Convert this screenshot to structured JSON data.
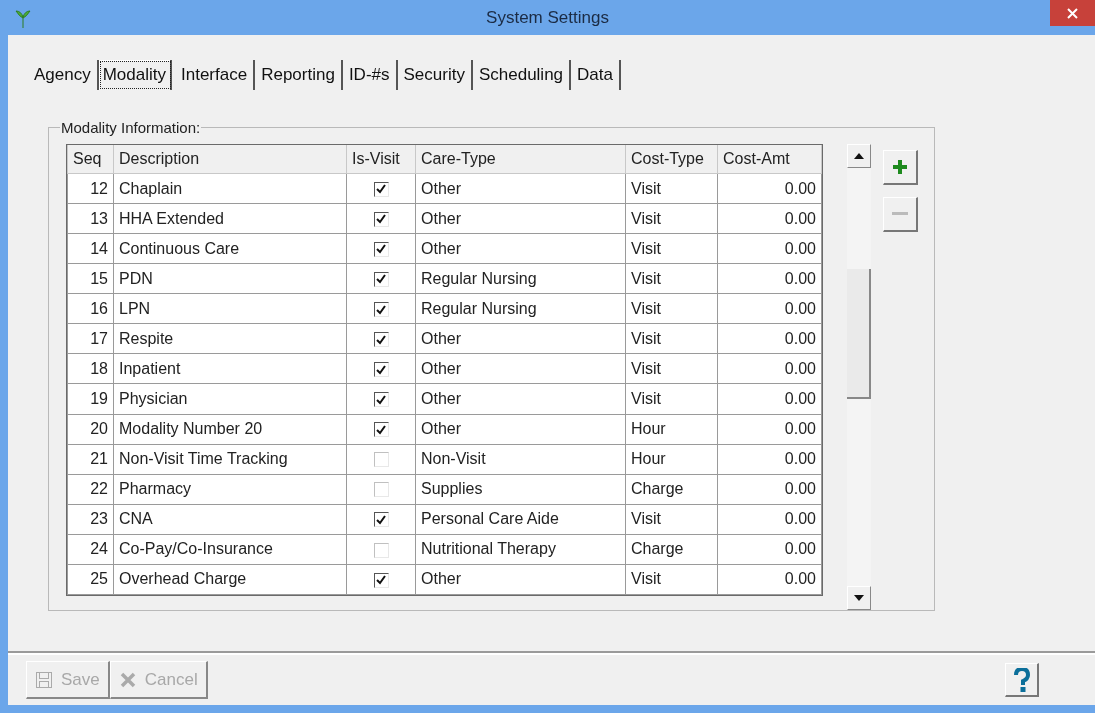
{
  "window": {
    "title": "System Settings"
  },
  "tabs": [
    {
      "label": "Agency",
      "selected": false
    },
    {
      "label": "Modality",
      "selected": true
    },
    {
      "label": "Interface",
      "selected": false
    },
    {
      "label": "Reporting",
      "selected": false
    },
    {
      "label": "ID-#s",
      "selected": false
    },
    {
      "label": "Security",
      "selected": false
    },
    {
      "label": "Scheduling",
      "selected": false
    },
    {
      "label": "Data",
      "selected": false
    }
  ],
  "group": {
    "title": "Modality Information:"
  },
  "table": {
    "columns": [
      "Seq",
      "Description",
      "Is-Visit",
      "Care-Type",
      "Cost-Type",
      "Cost-Amt"
    ],
    "rows": [
      {
        "seq": "12",
        "description": "Chaplain",
        "is_visit": true,
        "care_type": "Other",
        "cost_type": "Visit",
        "cost_amt": "0.00"
      },
      {
        "seq": "13",
        "description": "HHA Extended",
        "is_visit": true,
        "care_type": "Other",
        "cost_type": "Visit",
        "cost_amt": "0.00"
      },
      {
        "seq": "14",
        "description": "Continuous Care",
        "is_visit": true,
        "care_type": "Other",
        "cost_type": "Visit",
        "cost_amt": "0.00"
      },
      {
        "seq": "15",
        "description": "PDN",
        "is_visit": true,
        "care_type": "Regular Nursing",
        "cost_type": "Visit",
        "cost_amt": "0.00"
      },
      {
        "seq": "16",
        "description": "LPN",
        "is_visit": true,
        "care_type": "Regular Nursing",
        "cost_type": "Visit",
        "cost_amt": "0.00"
      },
      {
        "seq": "17",
        "description": "Respite",
        "is_visit": true,
        "care_type": "Other",
        "cost_type": "Visit",
        "cost_amt": "0.00"
      },
      {
        "seq": "18",
        "description": "Inpatient",
        "is_visit": true,
        "care_type": "Other",
        "cost_type": "Visit",
        "cost_amt": "0.00"
      },
      {
        "seq": "19",
        "description": "Physician",
        "is_visit": true,
        "care_type": "Other",
        "cost_type": "Visit",
        "cost_amt": "0.00"
      },
      {
        "seq": "20",
        "description": "Modality Number 20",
        "is_visit": true,
        "care_type": "Other",
        "cost_type": "Hour",
        "cost_amt": "0.00"
      },
      {
        "seq": "21",
        "description": "Non-Visit Time Tracking",
        "is_visit": false,
        "care_type": "Non-Visit",
        "cost_type": "Hour",
        "cost_amt": "0.00"
      },
      {
        "seq": "22",
        "description": "Pharmacy",
        "is_visit": false,
        "care_type": "Supplies",
        "cost_type": "Charge",
        "cost_amt": "0.00"
      },
      {
        "seq": "23",
        "description": "CNA",
        "is_visit": true,
        "care_type": "Personal Care Aide",
        "cost_type": "Visit",
        "cost_amt": "0.00"
      },
      {
        "seq": "24",
        "description": "Co-Pay/Co-Insurance",
        "is_visit": false,
        "care_type": "Nutritional Therapy",
        "cost_type": "Charge",
        "cost_amt": "0.00"
      },
      {
        "seq": "25",
        "description": "Overhead Charge",
        "is_visit": true,
        "care_type": "Other",
        "cost_type": "Visit",
        "cost_amt": "0.00"
      }
    ]
  },
  "footer": {
    "buttons": [
      {
        "kind": "save",
        "label": "Save",
        "disabled": true
      },
      {
        "kind": "cancel",
        "label": "Cancel",
        "disabled": true
      }
    ]
  }
}
